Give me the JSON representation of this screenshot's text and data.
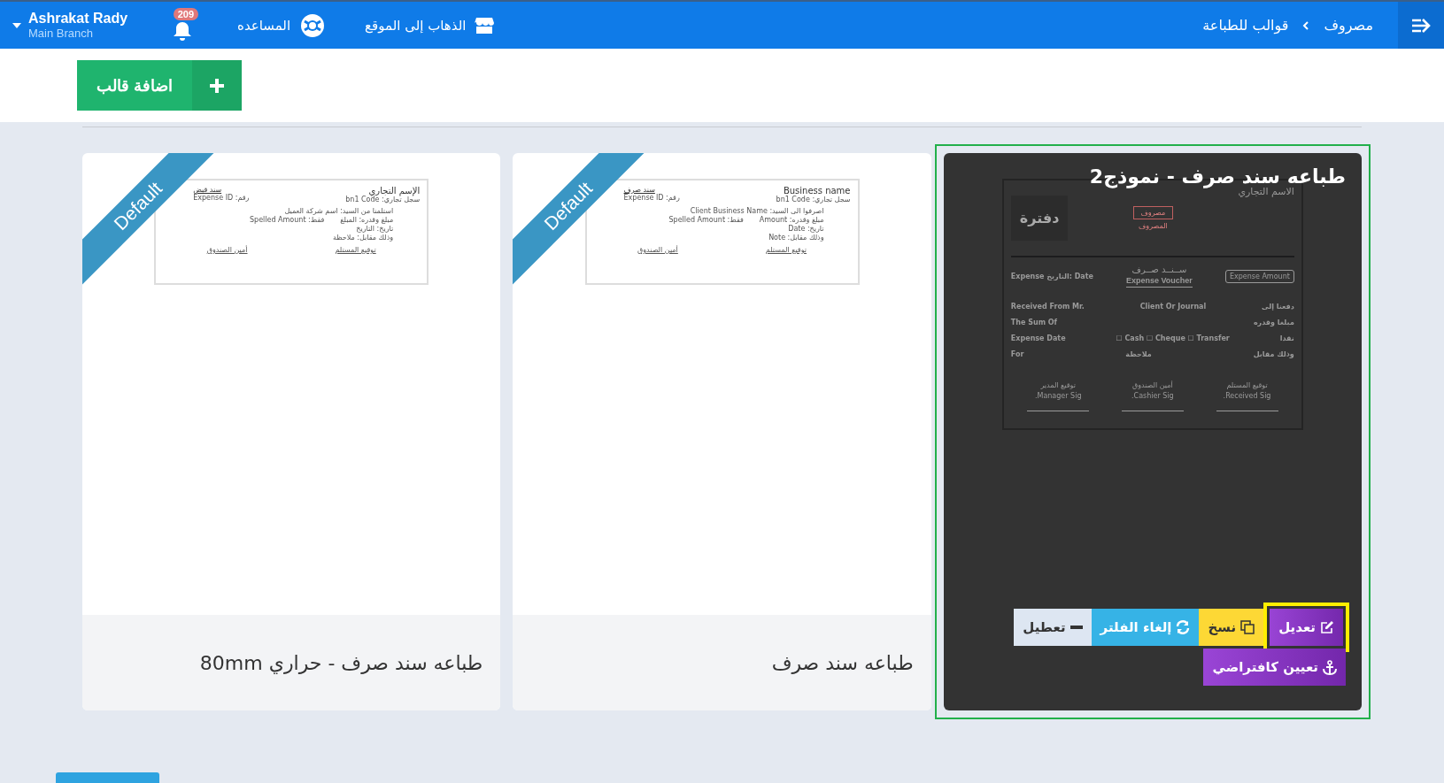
{
  "topbar": {
    "breadcrumb": [
      "مصروف",
      "قوالب للطباعة"
    ],
    "links": [
      {
        "label": "الذهاب إلى الموقع"
      },
      {
        "label": "المساعده"
      }
    ],
    "notifications": {
      "count": "209"
    },
    "user": {
      "name": "Ashrakat Rady",
      "branch": "Main Branch"
    }
  },
  "toolbar": {
    "add_button": "اضافة قالب"
  },
  "templates": [
    {
      "title": "طباعه سند صرف - نموذج2",
      "default": false,
      "selected": true,
      "preview": {
        "kind": "voucher",
        "name": "الاسم التجاري",
        "stamp": "مصروف",
        "stamp_note": "المصروف",
        "logo": "دفترة",
        "date": "Expense التاريخ: Date",
        "heading": "ســنــد صــرف",
        "heading_en": "Expense Voucher",
        "amount": "Expense Amount",
        "rows": [
          {
            "en": "Received From Mr.",
            "mid": "Client Or Journal",
            "ar": "دفعنا إلى"
          },
          {
            "en": "The Sum Of",
            "mid": "",
            "ar": "مبلغا وقدره"
          },
          {
            "en": "Expense Date",
            "mid": "Cash ☐ Cheque ☐ Transfer ☐",
            "ar": "نقدا"
          },
          {
            "en": "For",
            "mid": "ملاحظة",
            "ar": "وذلك مقابل"
          }
        ],
        "signatures": [
          {
            "ar": "توقيع المستلم",
            "en": "Received Sig."
          },
          {
            "ar": "أمين الصندوق",
            "en": "Cashier Sig."
          },
          {
            "ar": "توقيع المدير",
            "en": "Manager Sig."
          }
        ]
      },
      "actions": [
        {
          "kind": "edit",
          "label": "تعديل",
          "highlighted": true
        },
        {
          "kind": "copy",
          "label": "نسخ",
          "highlighted": false
        },
        {
          "kind": "unfilter",
          "label": "إلغاء الفلتر",
          "highlighted": false
        },
        {
          "kind": "disable",
          "label": "تعطيل",
          "highlighted": false
        },
        {
          "kind": "set_default",
          "label": "تعيين كافتراضي",
          "highlighted": false
        }
      ]
    },
    {
      "title": "طباعه سند صرف",
      "default": true,
      "selected": false,
      "ribbon": "Default",
      "preview": {
        "kind": "simple",
        "name": "Business name",
        "code": "سجل تجاري: bn1 Code",
        "voucher": "سند صرف",
        "id": "رقم: Expense ID",
        "rows": [
          "اصرفوا الى السيد: Client Business Name",
          "مبلغ وقدره: Amount",
          "تاريخ: Date",
          "وذلك مقابل: Note"
        ],
        "spelled": "فقط: Spelled Amount",
        "signatures": [
          "توقيع المستلم",
          "أمين الصندوق"
        ]
      }
    },
    {
      "title": "طباعه سند صرف - حراري 80mm",
      "default": true,
      "selected": false,
      "ribbon": "Default",
      "preview": {
        "kind": "simple",
        "name": "الإسم التجاري",
        "code": "سجل تجاري: bn1 Code",
        "voucher": "سند قبض",
        "id": "رقم: Expense ID",
        "rows": [
          "استلمنا من السيد: اسم شركة العميل",
          "مبلغ وقدره: المبلغ",
          "تاريخ: التاريخ",
          "وذلك مقابل: ملاحظة"
        ],
        "spelled": "فقط: Spelled Amount",
        "signatures": [
          "توقيع المستلم",
          "أمين الصندوق"
        ]
      }
    }
  ]
}
